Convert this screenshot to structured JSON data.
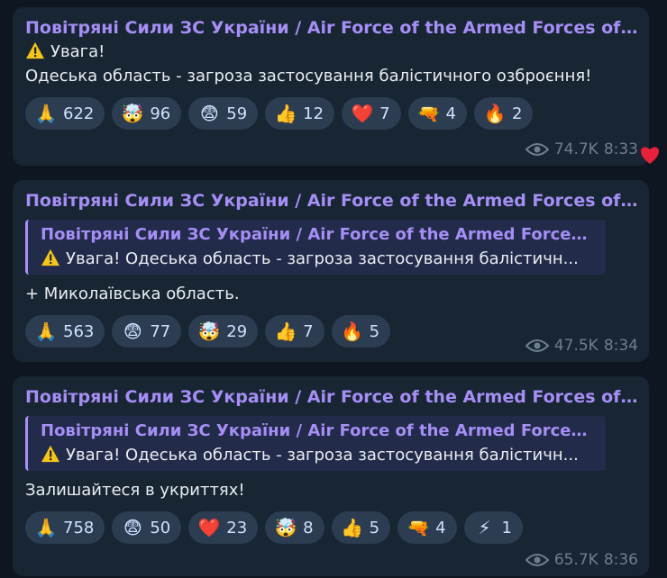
{
  "messages": [
    {
      "sender": "Повітряні Сили ЗС України / Air Force of the Armed Forces of ...",
      "lines": [
        "Увага!",
        "Одеська область - загроза застосування балістичного озброєння!"
      ],
      "reactions": [
        {
          "emoji": "🙏",
          "icon": "pray-icon",
          "count": "622"
        },
        {
          "emoji": "🤯",
          "icon": "exploding-head-icon",
          "count": "96"
        },
        {
          "emoji": "😨",
          "icon": "fearful-face-icon",
          "count": "59"
        },
        {
          "emoji": "👍",
          "icon": "thumbs-up-icon",
          "count": "12"
        },
        {
          "emoji": "❤️",
          "icon": "heart-icon",
          "count": "7"
        },
        {
          "emoji": "🔫",
          "icon": "gun-icon",
          "count": "4"
        },
        {
          "emoji": "🔥",
          "icon": "fire-icon",
          "count": "2"
        }
      ],
      "views": "74.7K",
      "time": "8:33"
    },
    {
      "sender": "Повітряні Сили ЗС України / Air Force of the Armed Forces of ...",
      "quote_sender": "Повітряні Сили ЗС України / Air Force of the Armed Forces ...",
      "quote_text": "Увага! Одеська область - загроза застосування балістичн...",
      "text": "+ Миколаївська область.",
      "reactions": [
        {
          "emoji": "🙏",
          "icon": "pray-icon",
          "count": "563"
        },
        {
          "emoji": "😨",
          "icon": "fearful-face-icon",
          "count": "77"
        },
        {
          "emoji": "🤯",
          "icon": "exploding-head-icon",
          "count": "29"
        },
        {
          "emoji": "👍",
          "icon": "thumbs-up-icon",
          "count": "7"
        },
        {
          "emoji": "🔥",
          "icon": "fire-icon",
          "count": "5"
        }
      ],
      "views": "47.5K",
      "time": "8:34"
    },
    {
      "sender": "Повітряні Сили ЗС України / Air Force of the Armed Forces of ...",
      "quote_sender": "Повітряні Сили ЗС України / Air Force of the Armed Forces ...",
      "quote_text": "Увага! Одеська область - загроза застосування балістичн...",
      "text": "Залишайтеся в укриттях!",
      "reactions": [
        {
          "emoji": "🙏",
          "icon": "pray-icon",
          "count": "758"
        },
        {
          "emoji": "😨",
          "icon": "fearful-face-icon",
          "count": "50"
        },
        {
          "emoji": "❤️",
          "icon": "heart-icon",
          "count": "23"
        },
        {
          "emoji": "🤯",
          "icon": "exploding-head-icon",
          "count": "8"
        },
        {
          "emoji": "👍",
          "icon": "thumbs-up-icon",
          "count": "5"
        },
        {
          "emoji": "🔫",
          "icon": "gun-icon",
          "count": "4"
        },
        {
          "emoji": "⚡",
          "icon": "lightning-icon",
          "count": "1"
        }
      ],
      "views": "65.7K",
      "time": "8:36"
    }
  ],
  "colors": {
    "background": "#0e1621",
    "bubble": "#182533",
    "accent": "#a58ef5",
    "reaction_bg": "#2c3d52"
  }
}
